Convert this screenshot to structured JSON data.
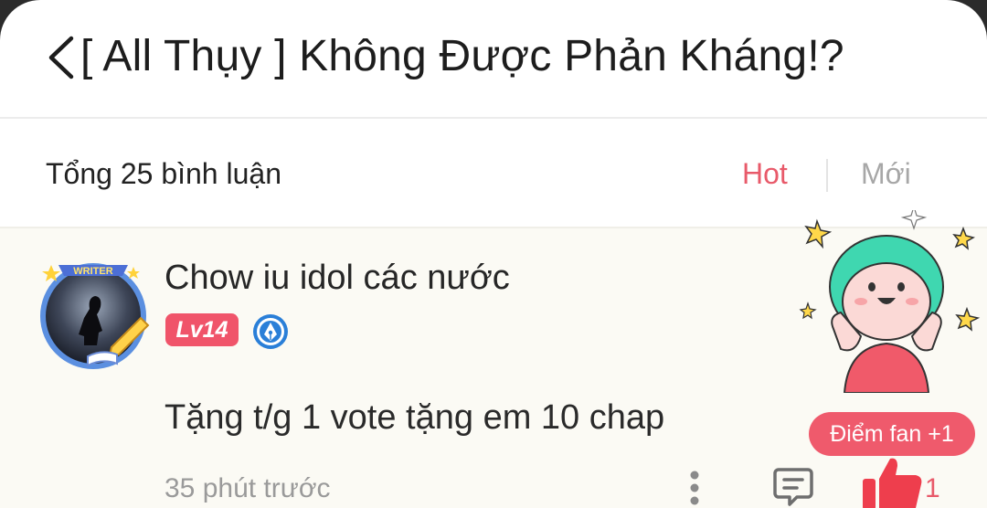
{
  "header": {
    "title": "[ All Thụy ] Không Được Phản Kháng!?"
  },
  "summary": {
    "total": "Tổng 25 bình luận",
    "sort_hot": "Hot",
    "sort_new": "Mới"
  },
  "comment": {
    "username": "Chow iu idol các nước",
    "level": "Lv14",
    "avatar_frame_text": "WRITER",
    "content": "Tặng t/g 1 vote tặng em 10 chap",
    "time": "35 phút trước",
    "like_count": "1",
    "fan_points": "Điểm fan +1"
  },
  "icons": {
    "back": "chevron-left-icon",
    "more": "more-vertical-icon",
    "reply": "comment-icon",
    "like": "thumbs-up-icon",
    "badge": "pen-nib-icon"
  },
  "colors": {
    "accent": "#e85a6a",
    "muted": "#a7a7a7",
    "comment_bg": "#fbfaf4",
    "level_badge": "#f0546a",
    "pen_badge": "#2a7fd8"
  }
}
